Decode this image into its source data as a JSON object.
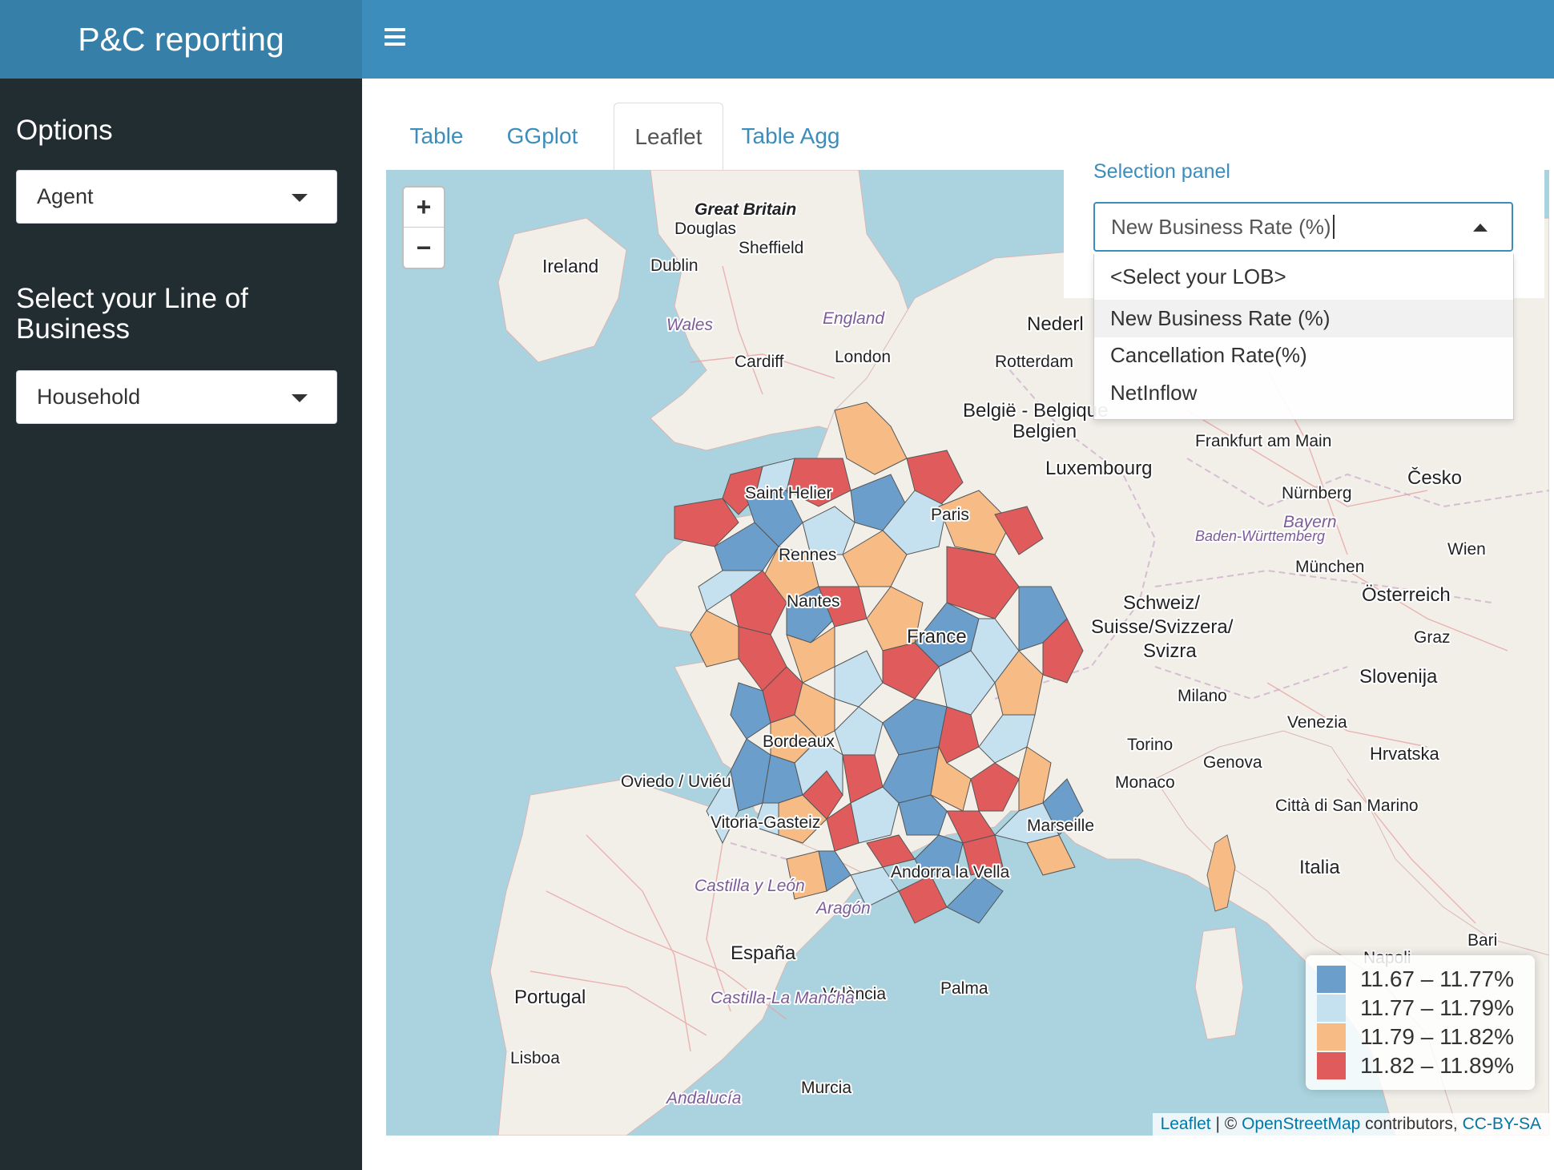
{
  "app": {
    "title": "P&C reporting"
  },
  "header": {
    "menu_icon": "hamburger-menu-icon"
  },
  "sidebar": {
    "options_label": "Options",
    "options_select": {
      "value": "Agent"
    },
    "lob_label": "Select your Line of Business",
    "lob_select": {
      "value": "Household"
    }
  },
  "tabs": [
    {
      "label": "Table",
      "active": false
    },
    {
      "label": "GGplot",
      "active": false
    },
    {
      "label": "Leaflet",
      "active": true
    },
    {
      "label": "Table Agg",
      "active": false
    }
  ],
  "selection_panel": {
    "title": "Selection panel",
    "value": "New Business Rate (%)",
    "options": [
      {
        "label": "<Select your LOB>",
        "selected": false
      },
      {
        "label": "New Business Rate (%)",
        "selected": true
      },
      {
        "label": "Cancellation Rate(%)",
        "selected": false
      },
      {
        "label": "NetInflow",
        "selected": false
      }
    ]
  },
  "map": {
    "zoom_in": "+",
    "zoom_out": "−",
    "colors": {
      "water": "#aad3df",
      "land": "#f2efe9",
      "c1": "#6b9ecb",
      "c2": "#c5e0ee",
      "c3": "#f7bc86",
      "c4": "#e05c5c"
    },
    "legend": [
      {
        "label": "11.67 – 11.77%",
        "color": "#6b9ecb"
      },
      {
        "label": "11.77 – 11.79%",
        "color": "#c5e0ee"
      },
      {
        "label": "11.79 – 11.82%",
        "color": "#f7bc86"
      },
      {
        "label": "11.82 – 11.89%",
        "color": "#e05c5c"
      }
    ],
    "attribution": {
      "leaflet": "Leaflet",
      "sep": " | © ",
      "osm": "OpenStreetMap",
      "contrib": " contributors, ",
      "license": "CC-BY-SA"
    },
    "place_labels": [
      "Great Britain",
      "Douglas",
      "Sheffield",
      "Ireland",
      "Dublin",
      "Wales",
      "England",
      "Cardiff",
      "London",
      "Rotterdam",
      "Nederl",
      "België - Belgique",
      "Belgien",
      "Luxembourg",
      "Frankfurt am Main",
      "Nürnberg",
      "Bayern",
      "Česko",
      "Wien",
      "München",
      "Österreich",
      "Graz",
      "Saint Helier",
      "Rennes",
      "Nantes",
      "Paris",
      "France",
      "Schweiz/",
      "Suisse/Svizzera/",
      "Svizra",
      "Milano",
      "Venezia",
      "Slovenija",
      "Hrvatska",
      "Torino",
      "Genova",
      "Monaco",
      "Marseille",
      "Bordeaux",
      "Oviedo / Uviéu",
      "Vitoria-Gasteiz",
      "Andorra la Vella",
      "Castilla y León",
      "Aragón",
      "España",
      "Portugal",
      "Lisboa",
      "València",
      "Palma",
      "Castilla-La Mancha",
      "Andalucía",
      "Murcia",
      "Città di San Marino",
      "Italia",
      "Bari",
      "Napoli",
      "Baden-Württemberg"
    ]
  }
}
